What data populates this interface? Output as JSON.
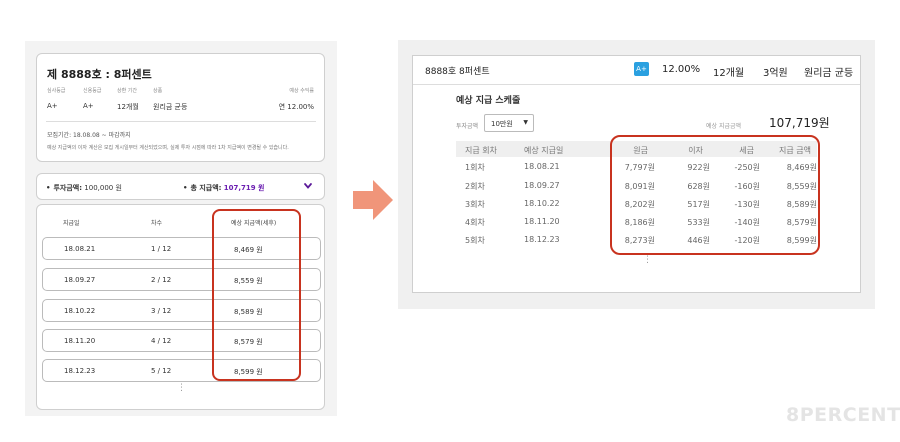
{
  "mobile": {
    "product_title": "제 8888호 : 8퍼센트",
    "info_columns": [
      {
        "label": "심사등급",
        "value": "A+"
      },
      {
        "label": "신용등급",
        "value": "A+"
      },
      {
        "label": "상환 기간",
        "value": "12개월"
      },
      {
        "label": "상품",
        "value": "원리금 균등"
      },
      {
        "label": "예상 수익률",
        "value": "연 12.00%"
      }
    ],
    "period": "모집기간: 18.08.08 ~ 마감까지",
    "note": "예상 지급액의 이자 계산은 모집 게시일부터 계산되었으며, 실제 투자 시점에 따라 1차 지급액이 변경될 수 있습니다.",
    "summary": {
      "investment_label": "투자금액:",
      "investment_value": "100,000 원",
      "total_label": "총 지급액:",
      "total_value": "107,719 원"
    },
    "list_headers": [
      "지급일",
      "차수",
      "예상 지급액(세후)"
    ],
    "rows": [
      {
        "date": "18.08.21",
        "round": "1 / 12",
        "amount": "8,469 원"
      },
      {
        "date": "18.09.27",
        "round": "2 / 12",
        "amount": "8,559 원"
      },
      {
        "date": "18.10.22",
        "round": "3 / 12",
        "amount": "8,589 원"
      },
      {
        "date": "18.11.20",
        "round": "4 / 12",
        "amount": "8,579 원"
      },
      {
        "date": "18.12.23",
        "round": "5 / 12",
        "amount": "8,599 원"
      }
    ],
    "more_glyph": "⋮"
  },
  "desktop": {
    "header": {
      "title": "8888호 8퍼센트",
      "grade": "A+",
      "rate": "12.00%",
      "term": "12개월",
      "amount": "3억원",
      "type": "원리금 균등"
    },
    "subtitle": "예상 지급 스케줄",
    "amount_label": "투자금액",
    "amount_select": "10만원",
    "total_label": "예상 지급금액",
    "total_value": "107,719원",
    "columns": [
      "지급 회차",
      "예상 지급일",
      "원금",
      "이자",
      "세금",
      "지급 금액"
    ],
    "rows": [
      {
        "round": "1회차",
        "date": "18.08.21",
        "principal": "7,797원",
        "interest": "922원",
        "tax": "-250원",
        "pay": "8,469원"
      },
      {
        "round": "2회차",
        "date": "18.09.27",
        "principal": "8,091원",
        "interest": "628원",
        "tax": "-160원",
        "pay": "8,559원"
      },
      {
        "round": "3회차",
        "date": "18.10.22",
        "principal": "8,202원",
        "interest": "517원",
        "tax": "-130원",
        "pay": "8,589원"
      },
      {
        "round": "4회차",
        "date": "18.11.20",
        "principal": "8,186원",
        "interest": "533원",
        "tax": "-140원",
        "pay": "8,579원"
      },
      {
        "round": "5회차",
        "date": "18.12.23",
        "principal": "8,273원",
        "interest": "446원",
        "tax": "-120원",
        "pay": "8,599원"
      }
    ],
    "more_glyph": "⋮"
  },
  "watermark": "8PERCENT",
  "colors": {
    "highlight": "#c8331f",
    "arrow": "#f0957a",
    "grade_badge": "#2aa0e0",
    "total_accent": "#6b1fb1"
  }
}
